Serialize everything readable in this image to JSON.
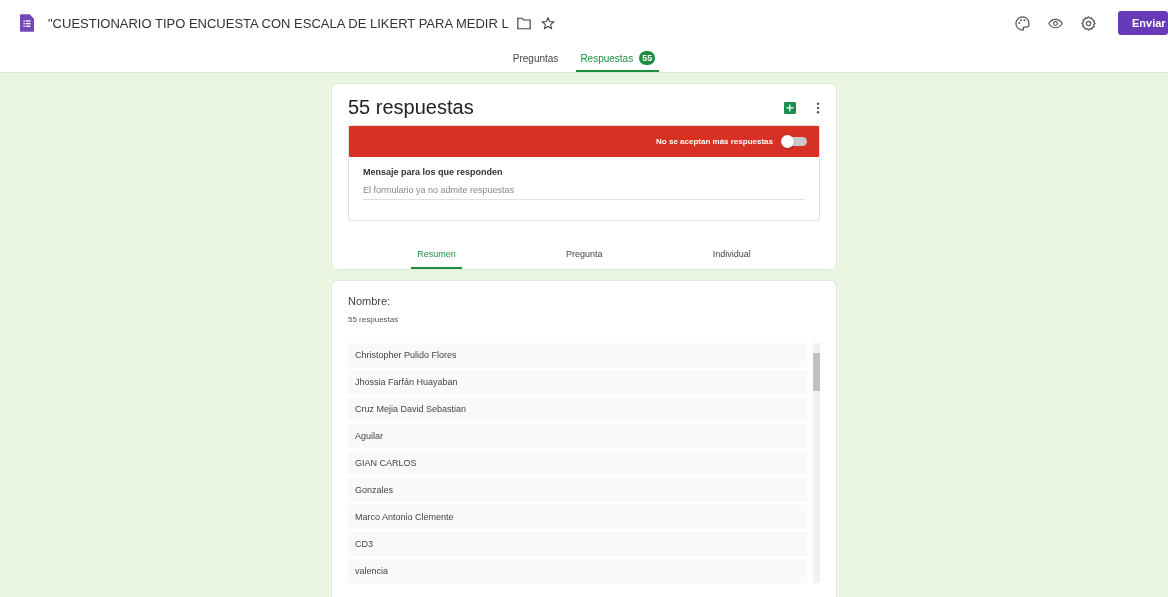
{
  "header": {
    "title": "\"CUESTIONARIO TIPO ENCUESTA CON ESCALA DE LIKERT PARA MEDIR L",
    "send_button": "Enviar"
  },
  "tabs": [
    {
      "label": "Preguntas",
      "selected": false
    },
    {
      "label": "Respuestas",
      "selected": true,
      "badge": "55"
    }
  ],
  "summary_card": {
    "title": "55 respuestas",
    "banner": {
      "label": "No se aceptan más respuestas",
      "accepting": false
    },
    "message_label": "Mensaje para los que responden",
    "message_value": "El formulario ya no admite respuestas",
    "view_tabs": [
      {
        "label": "Resumen",
        "selected": true
      },
      {
        "label": "Pregunta",
        "selected": false
      },
      {
        "label": "Individual",
        "selected": false
      }
    ]
  },
  "question_card": {
    "question": "Nombre:",
    "count": "55 respuestas",
    "answers": [
      "Christopher Pulido Flores",
      "Jhossia Farfán Huayaban",
      "Cruz Mejia David Sebastian",
      "Aguilar",
      "GIAN CARLOS",
      "Gonzales",
      "Marco Antonio Clemente",
      "CD3",
      "valencia"
    ]
  }
}
